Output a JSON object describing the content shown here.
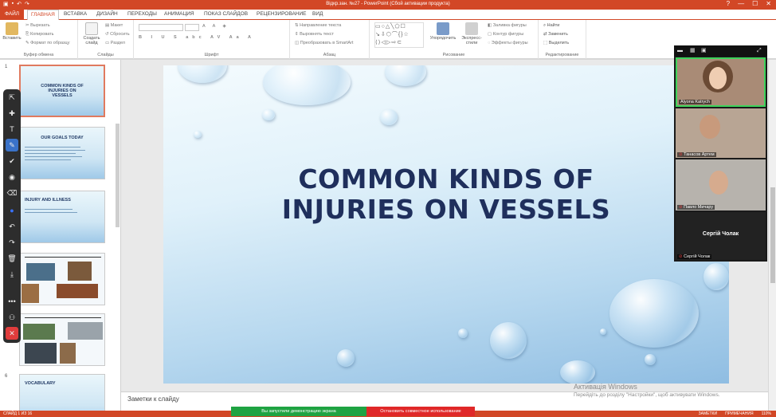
{
  "window": {
    "title": "Відкр.зан. №27  -  PowerPoint (Сбой активации продукта)",
    "controls": [
      "?",
      "—",
      "☐",
      "✕"
    ]
  },
  "tabs": [
    {
      "label": "ФАЙЛ"
    },
    {
      "label": "ГЛАВНАЯ"
    },
    {
      "label": "ВСТАВКА"
    },
    {
      "label": "ДИЗАЙН"
    },
    {
      "label": "ПЕРЕХОДЫ"
    },
    {
      "label": "АНИМАЦИЯ"
    },
    {
      "label": "ПОКАЗ СЛАЙДОВ"
    },
    {
      "label": "РЕЦЕНЗИРОВАНИЕ"
    },
    {
      "label": "ВИД"
    }
  ],
  "ribbon": {
    "clipboard": {
      "paste": "Вставить",
      "cut": "Вырезать",
      "copy": "Копировать",
      "format": "Формат по образцу",
      "label": "Буфер обмена"
    },
    "slides": {
      "new": "Создать слайд",
      "layout": "Макет",
      "reset": "Сбросить",
      "section": "Раздел",
      "label": "Слайды"
    },
    "font": {
      "label": "Шрифт"
    },
    "paragraph": {
      "text_dir": "Направление текста",
      "align_text": "Выровнять текст",
      "smartart": "Преобразовать в SmartArt",
      "label": "Абзац"
    },
    "drawing": {
      "arrange": "Упорядочить",
      "quick_styles": "Экспресс-стили",
      "fill": "Заливка фигуры",
      "outline": "Контур фигуры",
      "effects": "Эффекты фигуры",
      "label": "Рисование"
    },
    "editing": {
      "find": "Найти",
      "replace": "Заменить",
      "select": "Выделить",
      "label": "Редактирование"
    }
  },
  "thumbnails": [
    {
      "num": "1",
      "title": "COMMON KINDS OF INJURIES ON VESSELS"
    },
    {
      "num": "",
      "title": "OUR GOALS TODAY"
    },
    {
      "num": "",
      "title": "INJURY AND ILLNESS"
    },
    {
      "num": "",
      "title": ""
    },
    {
      "num": "",
      "title": ""
    },
    {
      "num": "6",
      "title": "VOCABULARY"
    }
  ],
  "slide": {
    "title_line1": "COMMON KINDS OF",
    "title_line2": "INJURIES ON VESSELS"
  },
  "notes": {
    "placeholder": "Заметки к слайду"
  },
  "watermark": {
    "line1": "Активація Windows",
    "line2": "Перейдіть до розділу \"Настройки\", щоб активувати Windows."
  },
  "status": {
    "slide_info": "СЛАЙД 1 ИЗ 16",
    "notes": "ЗАМЕТКИ",
    "comments": "ПРИМЕЧАНИЯ",
    "zoom": "110%"
  },
  "share": {
    "demo": "Вы запустили демонстрацию экрана",
    "stop": "Остановить совместное использование"
  },
  "participants": [
    {
      "name": "Alyona Katrych",
      "muted": false
    },
    {
      "name": "Танасов Артем",
      "muted": true
    },
    {
      "name": "Павло Мичару",
      "muted": true
    },
    {
      "name": "Сергій Чолак",
      "muted": true,
      "display_name": "Сергій Чолак"
    }
  ],
  "colors": {
    "accent": "#d24726",
    "slide_title": "#1f2f5c",
    "share_green": "#1fa342",
    "share_red": "#e02828"
  },
  "annotation_tools": [
    "select-icon",
    "move-icon",
    "text-icon",
    "pen-icon",
    "checkmark-icon",
    "spotlight-icon",
    "eraser-icon",
    "color-icon",
    "undo-icon",
    "redo-icon",
    "trash-icon",
    "save-icon",
    "more-icon",
    "share-icon",
    "close-icon"
  ]
}
